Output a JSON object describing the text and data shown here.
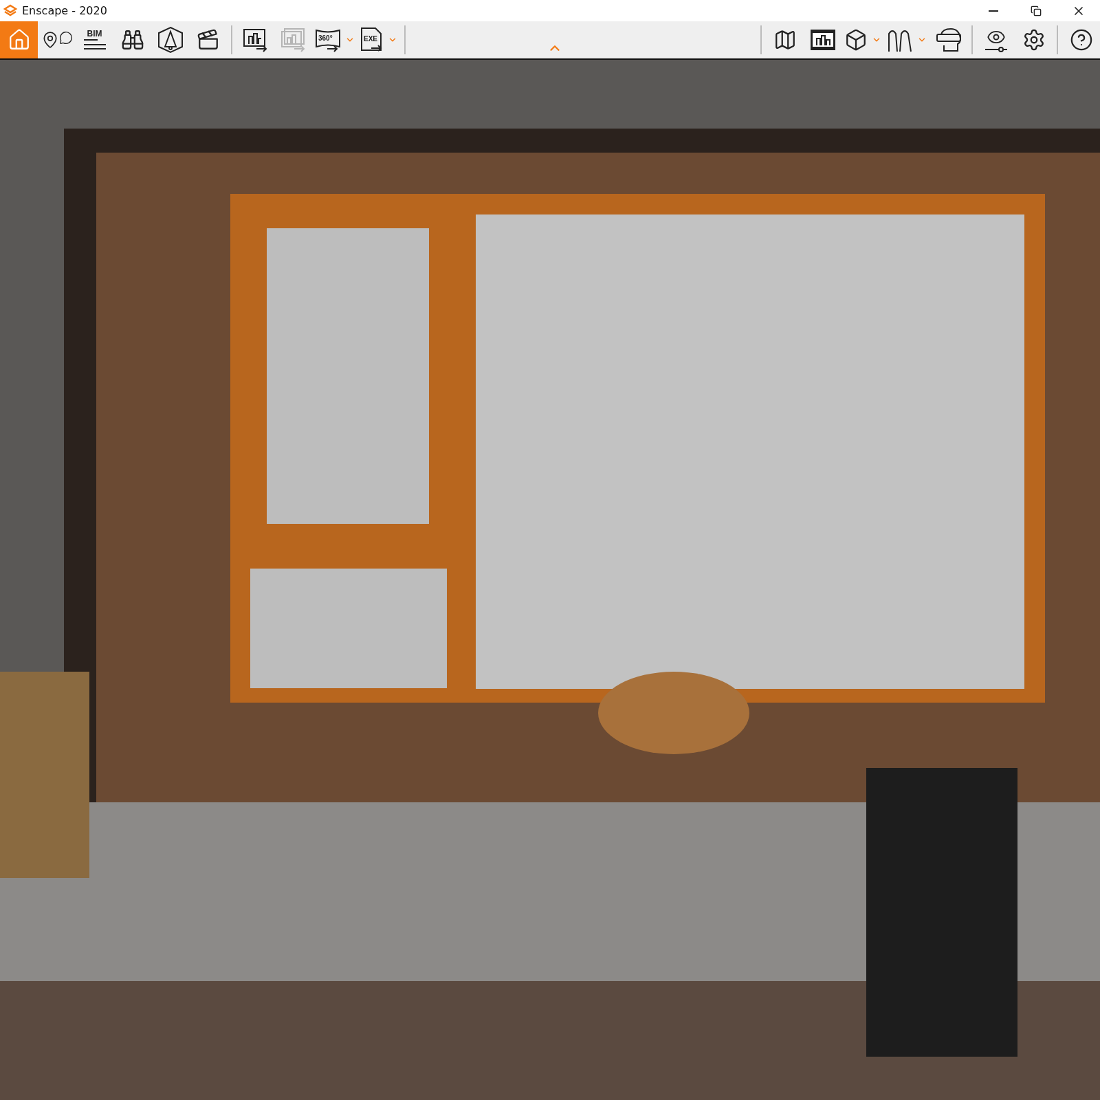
{
  "window": {
    "title": "Enscape - 2020"
  },
  "toolbar": {
    "left_groups": [
      [
        {
          "selected": true,
          "disabled": false,
          "has_menu": false
        },
        {
          "selected": false,
          "disabled": false,
          "has_menu": false
        },
        {
          "selected": false,
          "disabled": false,
          "has_menu": false,
          "label": "BIM"
        },
        {
          "selected": false,
          "disabled": false,
          "has_menu": false
        },
        {
          "selected": false,
          "disabled": false,
          "has_menu": false
        },
        {
          "selected": false,
          "disabled": false,
          "has_menu": false
        }
      ],
      [
        {
          "selected": false,
          "disabled": false,
          "has_menu": false
        },
        {
          "selected": false,
          "disabled": true,
          "has_menu": false
        },
        {
          "selected": false,
          "disabled": false,
          "has_menu": true,
          "label": "360°"
        },
        {
          "selected": false,
          "disabled": false,
          "has_menu": true,
          "label": "EXE"
        }
      ]
    ],
    "right_groups": [
      [
        {
          "selected": false,
          "disabled": false,
          "has_menu": false
        },
        {
          "selected": false,
          "disabled": false,
          "has_menu": false
        },
        {
          "selected": false,
          "disabled": false,
          "has_menu": true
        },
        {
          "selected": false,
          "disabled": false,
          "has_menu": true
        },
        {
          "selected": false,
          "disabled": false,
          "has_menu": false
        }
      ],
      [
        {
          "selected": false,
          "disabled": false,
          "has_menu": false
        },
        {
          "selected": false,
          "disabled": false,
          "has_menu": false
        }
      ],
      [
        {
          "selected": false,
          "disabled": false,
          "has_menu": false
        }
      ]
    ]
  }
}
